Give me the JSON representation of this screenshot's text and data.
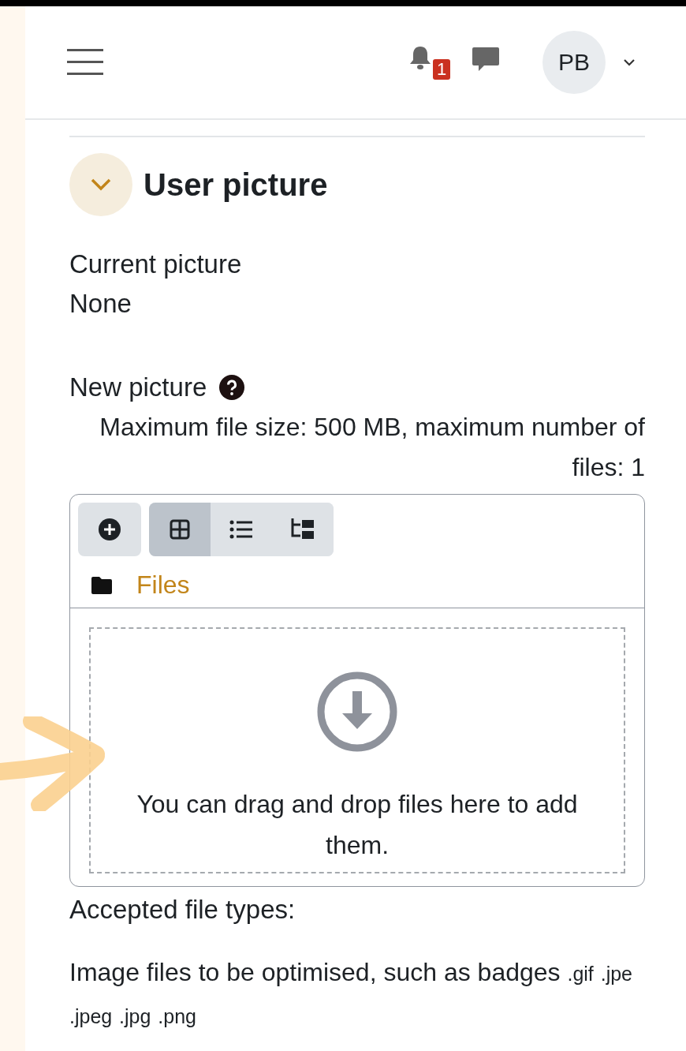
{
  "header": {
    "notification_count": "1",
    "avatar_initials": "PB"
  },
  "section": {
    "title": "User picture",
    "expanded": true
  },
  "current_picture": {
    "label": "Current picture",
    "value": "None"
  },
  "new_picture": {
    "label": "New picture",
    "limits": "Maximum file size: 500 MB, maximum number of files: 1"
  },
  "file_picker": {
    "view_buttons": [
      {
        "kind": "grid",
        "selected": true
      },
      {
        "kind": "list",
        "selected": false
      },
      {
        "kind": "tree",
        "selected": false
      }
    ],
    "path": "Files",
    "dropzone_text": "You can drag and drop files here to add them."
  },
  "accepted": {
    "label": "Accepted file types:",
    "description": "Image files to be optimised, such as badges",
    "extensions": [
      ".gif",
      ".jpe",
      ".jpeg",
      ".jpg",
      ".png"
    ]
  }
}
